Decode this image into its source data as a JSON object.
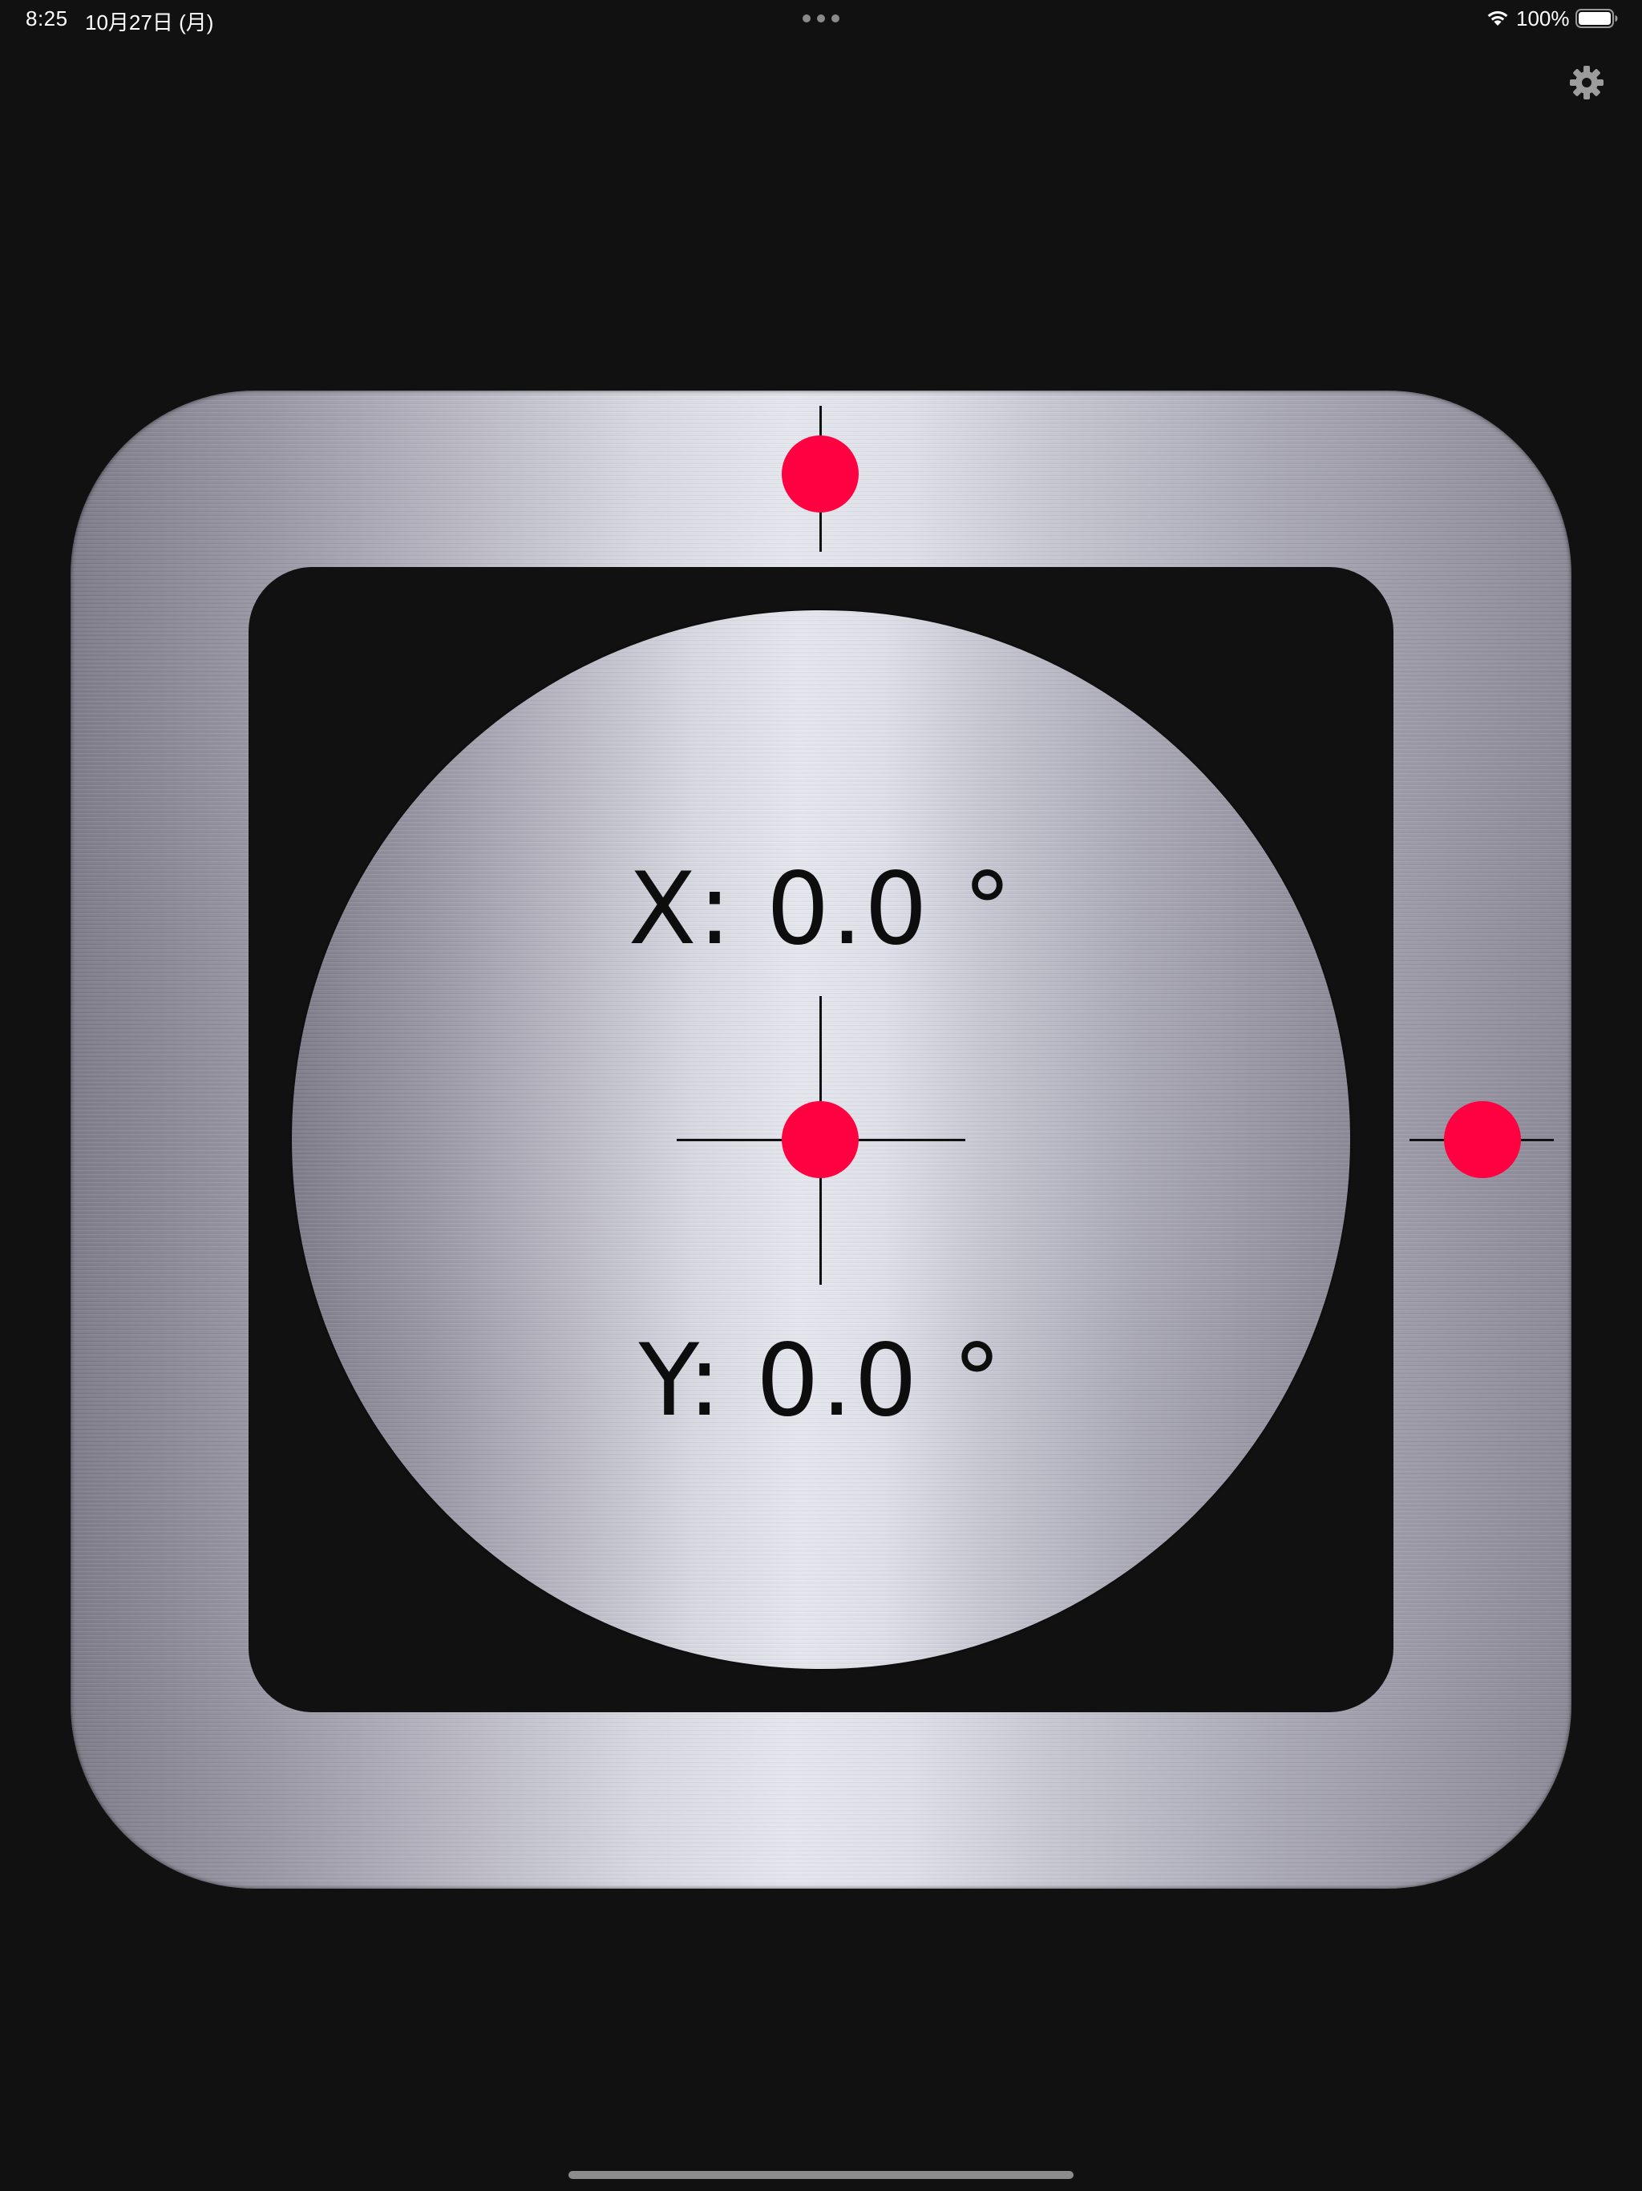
{
  "status_bar": {
    "time": "8:25",
    "date": "10月27日 (月)",
    "battery_percent": "100%",
    "wifi_icon": "wifi-icon",
    "battery_icon": "battery-full-icon"
  },
  "toolbar": {
    "settings_icon": "gear-icon"
  },
  "level": {
    "x_readout": "X: 0.0 °",
    "y_readout": "Y: 0.0 °",
    "bubble_color": "#ff0040",
    "x_angle_deg": 0.0,
    "y_angle_deg": 0.0
  }
}
